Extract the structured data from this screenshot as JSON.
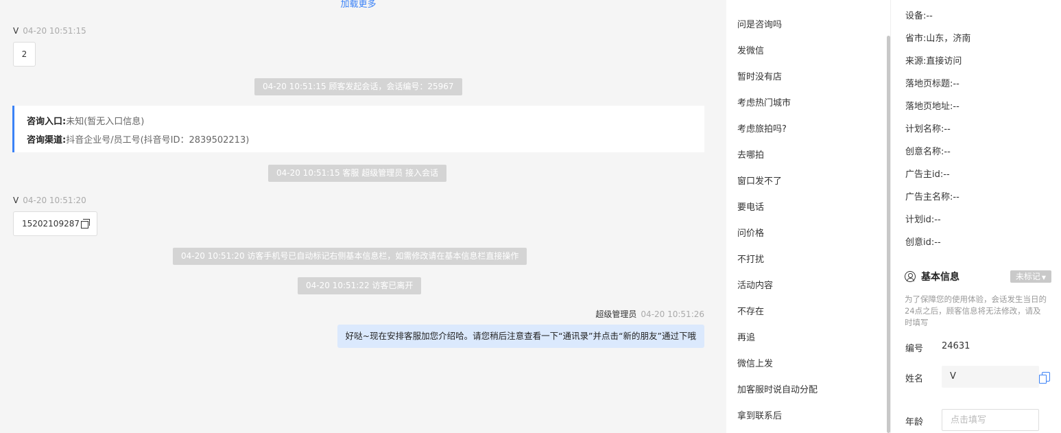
{
  "chat": {
    "load_more": "加载更多",
    "messages": [
      {
        "sender": "V",
        "time": "04-20 10:51:15",
        "text": "2"
      },
      {
        "sender": "V",
        "time": "04-20 10:51:20",
        "text": "15202109287"
      }
    ],
    "system": {
      "start": "04-20 10:51:15 顾客发起会话，会话编号：25967",
      "joined": "04-20 10:51:15 客服 超级管理员 接入会话",
      "phone_marked": "04-20 10:51:20 访客手机号已自动标记右侧基本信息栏，如需修改请在基本信息栏直接操作",
      "left": "04-20 10:51:22 访客已离开"
    },
    "consult": {
      "entry_label": "咨询入口:",
      "entry_value": "未知(暂无入口信息)",
      "channel_label": "咨询渠道:",
      "channel_value": "抖音企业号/员工号(抖音号ID：2839502213)"
    },
    "agent": {
      "name": "超级管理员",
      "time": "04-20 10:51:26",
      "text": "好哒~现在安排客服加您介绍哈。请您稍后注意查看一下“通讯录”并点击“新的朋友”通过下哦"
    }
  },
  "quick_replies": [
    "问是咨询吗",
    "发微信",
    "暂时没有店",
    "考虑热门城市",
    "考虑旅拍吗?",
    "去哪拍",
    "窗口发不了",
    "要电话",
    "问价格",
    "不打扰",
    "活动内容",
    "不存在",
    "再追",
    "微信上发",
    "加客服时说自动分配",
    "拿到联系后"
  ],
  "visitor_info": {
    "items": [
      {
        "label": "设备:",
        "value": "--"
      },
      {
        "label": "省市:",
        "value": "山东，济南"
      },
      {
        "label": "来源:",
        "value": "直接访问"
      },
      {
        "label": "落地页标题:",
        "value": "--"
      },
      {
        "label": "落地页地址:",
        "value": "--"
      },
      {
        "label": "计划名称:",
        "value": "--"
      },
      {
        "label": "创意名称:",
        "value": "--"
      },
      {
        "label": "广告主id:",
        "value": "--"
      },
      {
        "label": "广告主名称:",
        "value": "--"
      },
      {
        "label": "计划id:",
        "value": "--"
      },
      {
        "label": "创意id:",
        "value": "--"
      }
    ]
  },
  "basic_info": {
    "title": "基本信息",
    "tag_select": "未标记",
    "notice": "为了保障您的使用体验，会话发生当日的24点之后，顾客信息将无法修改，请及时填写",
    "id_label": "编号",
    "id_value": "24631",
    "name_label": "姓名",
    "name_value": "V",
    "age_label": "年龄",
    "age_placeholder": "点击填写"
  },
  "colors": {
    "accent": "#3b82f6",
    "agent_bubble": "#dbe9fd",
    "system_bubble": "#d4d4d4"
  }
}
